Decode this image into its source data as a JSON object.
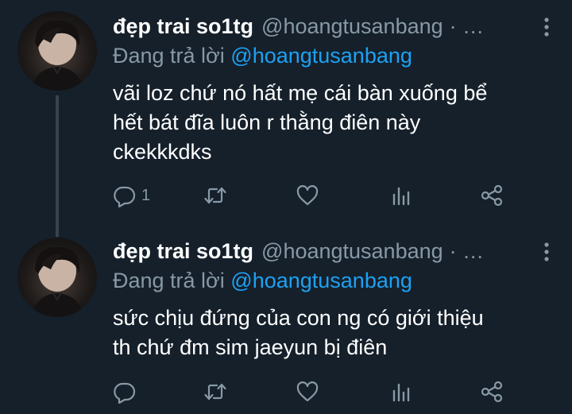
{
  "tweets": [
    {
      "display_name": "đẹp trai so1tg",
      "handle": "@hoangtusanbang",
      "separator": "· …",
      "replying_prefix": "Đang trả lời",
      "replying_to": "@hoangtusanbang",
      "text_lines": [
        "vãi loz chứ nó hất mẹ cái bàn xuống bể",
        "hết bát đĩa luôn r thằng điên này",
        "ckekkkdks"
      ],
      "reply_count": "1",
      "icons": [
        "comment-icon",
        "retweet-icon",
        "heart-icon",
        "analytics-icon",
        "share-icon",
        "more-vertical-icon"
      ]
    },
    {
      "display_name": "đẹp trai so1tg",
      "handle": "@hoangtusanbang",
      "separator": "· …",
      "replying_prefix": "Đang trả lời",
      "replying_to": "@hoangtusanbang",
      "text_lines": [
        "sức chịu đứng của con ng có giới thiệu",
        "th chứ đm sim jaeyun bị điên"
      ],
      "reply_count": "",
      "icons": [
        "comment-icon",
        "retweet-icon",
        "heart-icon",
        "analytics-icon",
        "share-icon",
        "more-vertical-icon"
      ]
    }
  ],
  "colors": {
    "background": "#15202b",
    "text_primary": "#ffffff",
    "text_secondary": "#8899a6",
    "accent": "#1da1f2",
    "thread_line": "#38444d"
  }
}
